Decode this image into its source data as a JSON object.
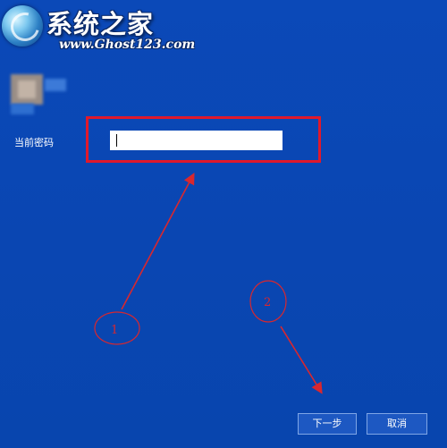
{
  "watermark": {
    "title": "系统之家",
    "url": "www.Ghost123.com"
  },
  "form": {
    "password_label": "当前密码",
    "password_value": ""
  },
  "annotations": {
    "step1": "1",
    "step2": "2",
    "color": "#d9272e"
  },
  "buttons": {
    "next": "下一步",
    "cancel": "取消"
  },
  "colors": {
    "background": "#0a47b5",
    "highlight": "#e0192b"
  }
}
